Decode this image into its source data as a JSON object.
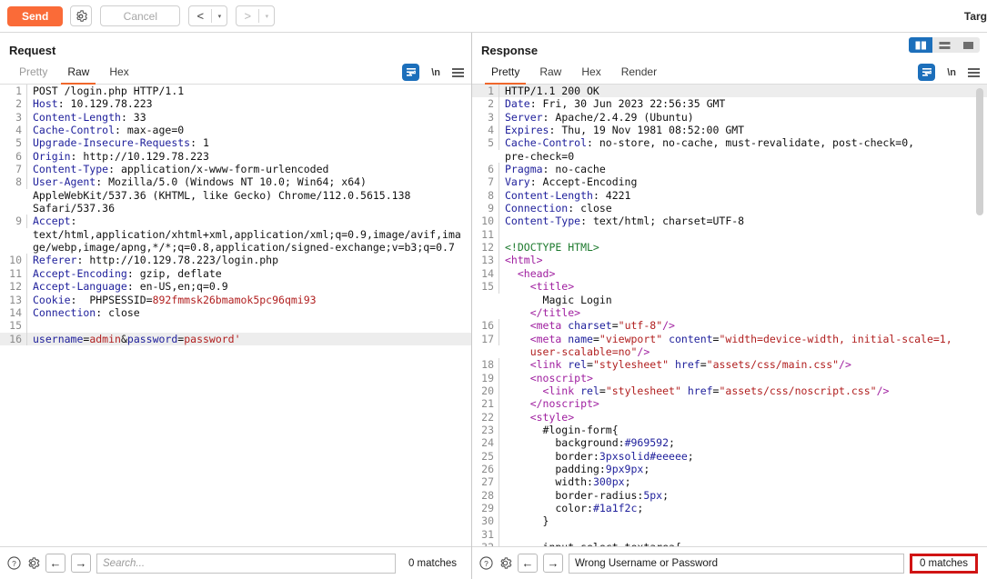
{
  "toolbar": {
    "send_label": "Send",
    "settings_icon": "gear-icon",
    "cancel_label": "Cancel",
    "prev_label": "<",
    "next_label": ">",
    "dropdown_caret": "▾",
    "target_label": "Targ"
  },
  "request": {
    "title": "Request",
    "tabs": [
      {
        "label": "Pretty",
        "active": false
      },
      {
        "label": "Raw",
        "active": true
      },
      {
        "label": "Hex",
        "active": false
      }
    ],
    "tools": {
      "wrap_icon": "word-wrap-icon",
      "newline_label": "\\n",
      "menu_icon": "hamburger-menu-icon"
    },
    "search": {
      "placeholder": "Search...",
      "value": "",
      "matches": "0 matches",
      "help_icon": "help-icon",
      "settings_icon": "gear-icon",
      "prev_icon": "arrow-left-icon",
      "next_icon": "arrow-right-icon"
    },
    "lines": [
      {
        "n": "1",
        "parts": [
          {
            "t": "POST /login.php HTTP/1.1",
            "c": "k-val"
          }
        ]
      },
      {
        "n": "2",
        "parts": [
          {
            "t": "Host",
            "c": "k-hdr"
          },
          {
            "t": ": 10.129.78.223",
            "c": "k-val"
          }
        ]
      },
      {
        "n": "3",
        "parts": [
          {
            "t": "Content-Length",
            "c": "k-hdr"
          },
          {
            "t": ": 33",
            "c": "k-val"
          }
        ]
      },
      {
        "n": "4",
        "parts": [
          {
            "t": "Cache-Control",
            "c": "k-hdr"
          },
          {
            "t": ": max-age=0",
            "c": "k-val"
          }
        ]
      },
      {
        "n": "5",
        "parts": [
          {
            "t": "Upgrade-Insecure-Requests",
            "c": "k-hdr"
          },
          {
            "t": ": 1",
            "c": "k-val"
          }
        ]
      },
      {
        "n": "6",
        "parts": [
          {
            "t": "Origin",
            "c": "k-hdr"
          },
          {
            "t": ": http://10.129.78.223",
            "c": "k-val"
          }
        ]
      },
      {
        "n": "7",
        "parts": [
          {
            "t": "Content-Type",
            "c": "k-hdr"
          },
          {
            "t": ": application/x-www-form-urlencoded",
            "c": "k-val"
          }
        ]
      },
      {
        "n": "8",
        "parts": [
          {
            "t": "User-Agent",
            "c": "k-hdr"
          },
          {
            "t": ": Mozilla/5.0 (Windows NT 10.0; Win64; x64)",
            "c": "k-val"
          }
        ]
      },
      {
        "n": "",
        "parts": [
          {
            "t": "AppleWebKit/537.36 (KHTML, like Gecko) Chrome/112.0.5615.138",
            "c": "k-val"
          }
        ]
      },
      {
        "n": "",
        "parts": [
          {
            "t": "Safari/537.36",
            "c": "k-val"
          }
        ]
      },
      {
        "n": "9",
        "parts": [
          {
            "t": "Accept",
            "c": "k-hdr"
          },
          {
            "t": ":",
            "c": "k-val"
          }
        ]
      },
      {
        "n": "",
        "parts": [
          {
            "t": "text/html,application/xhtml+xml,application/xml;q=0.9,image/avif,ima",
            "c": "k-val"
          }
        ]
      },
      {
        "n": "",
        "parts": [
          {
            "t": "ge/webp,image/apng,*/*;q=0.8,application/signed-exchange;v=b3;q=0.7",
            "c": "k-val"
          }
        ]
      },
      {
        "n": "10",
        "parts": [
          {
            "t": "Referer",
            "c": "k-hdr"
          },
          {
            "t": ": http://10.129.78.223/login.php",
            "c": "k-val"
          }
        ]
      },
      {
        "n": "11",
        "parts": [
          {
            "t": "Accept-Encoding",
            "c": "k-hdr"
          },
          {
            "t": ": gzip, deflate",
            "c": "k-val"
          }
        ]
      },
      {
        "n": "12",
        "parts": [
          {
            "t": "Accept-Language",
            "c": "k-hdr"
          },
          {
            "t": ": en-US,en;q=0.9",
            "c": "k-val"
          }
        ]
      },
      {
        "n": "13",
        "parts": [
          {
            "t": "Cookie",
            "c": "k-hdr"
          },
          {
            "t": ":  PHPSESSID=",
            "c": "k-val"
          },
          {
            "t": "892fmmsk26bmamok5pc96qmi93",
            "c": "k-red"
          }
        ]
      },
      {
        "n": "14",
        "parts": [
          {
            "t": "Connection",
            "c": "k-hdr"
          },
          {
            "t": ": close",
            "c": "k-val"
          }
        ]
      },
      {
        "n": "15",
        "parts": [
          {
            "t": "",
            "c": "k-val"
          }
        ]
      },
      {
        "n": "16",
        "hl": true,
        "parts": [
          {
            "t": "username",
            "c": "k-hdr"
          },
          {
            "t": "=",
            "c": "k-val"
          },
          {
            "t": "admin",
            "c": "k-red"
          },
          {
            "t": "&",
            "c": "k-val"
          },
          {
            "t": "password",
            "c": "k-hdr"
          },
          {
            "t": "=",
            "c": "k-val"
          },
          {
            "t": "password'",
            "c": "k-red"
          }
        ]
      }
    ]
  },
  "response": {
    "title": "Response",
    "tabs": [
      {
        "label": "Pretty",
        "active": true
      },
      {
        "label": "Raw",
        "active": false
      },
      {
        "label": "Hex",
        "active": false
      },
      {
        "label": "Render",
        "active": false
      }
    ],
    "tools": {
      "wrap_icon": "word-wrap-icon",
      "newline_label": "\\n",
      "menu_icon": "hamburger-menu-icon"
    },
    "layout_toggles": [
      {
        "name": "side-by-side-layout",
        "active": true
      },
      {
        "name": "stacked-layout",
        "active": false
      },
      {
        "name": "single-pane-layout",
        "active": false
      }
    ],
    "search": {
      "placeholder": "Search...",
      "value": "Wrong Username or Password",
      "matches": "0 matches",
      "help_icon": "help-icon",
      "settings_icon": "gear-icon",
      "prev_icon": "arrow-left-icon",
      "next_icon": "arrow-right-icon"
    },
    "lines": [
      {
        "n": "1",
        "hl": true,
        "parts": [
          {
            "t": "HTTP/1.1 200 OK",
            "c": "k-val"
          }
        ]
      },
      {
        "n": "2",
        "parts": [
          {
            "t": "Date",
            "c": "k-hdr"
          },
          {
            "t": ": Fri, 30 Jun 2023 22:56:35 GMT",
            "c": "k-val"
          }
        ]
      },
      {
        "n": "3",
        "parts": [
          {
            "t": "Server",
            "c": "k-hdr"
          },
          {
            "t": ": Apache/2.4.29 (Ubuntu)",
            "c": "k-val"
          }
        ]
      },
      {
        "n": "4",
        "parts": [
          {
            "t": "Expires",
            "c": "k-hdr"
          },
          {
            "t": ": Thu, 19 Nov 1981 08:52:00 GMT",
            "c": "k-val"
          }
        ]
      },
      {
        "n": "5",
        "parts": [
          {
            "t": "Cache-Control",
            "c": "k-hdr"
          },
          {
            "t": ": no-store, no-cache, must-revalidate, post-check=0,",
            "c": "k-val"
          }
        ]
      },
      {
        "n": "",
        "parts": [
          {
            "t": "pre-check=0",
            "c": "k-val"
          }
        ]
      },
      {
        "n": "6",
        "parts": [
          {
            "t": "Pragma",
            "c": "k-hdr"
          },
          {
            "t": ": no-cache",
            "c": "k-val"
          }
        ]
      },
      {
        "n": "7",
        "parts": [
          {
            "t": "Vary",
            "c": "k-hdr"
          },
          {
            "t": ": Accept-Encoding",
            "c": "k-val"
          }
        ]
      },
      {
        "n": "8",
        "parts": [
          {
            "t": "Content-Length",
            "c": "k-hdr"
          },
          {
            "t": ": 4221",
            "c": "k-val"
          }
        ]
      },
      {
        "n": "9",
        "parts": [
          {
            "t": "Connection",
            "c": "k-hdr"
          },
          {
            "t": ": close",
            "c": "k-val"
          }
        ]
      },
      {
        "n": "10",
        "parts": [
          {
            "t": "Content-Type",
            "c": "k-hdr"
          },
          {
            "t": ": text/html; charset=UTF-8",
            "c": "k-val"
          }
        ]
      },
      {
        "n": "11",
        "parts": [
          {
            "t": "",
            "c": "k-val"
          }
        ]
      },
      {
        "n": "12",
        "parts": [
          {
            "t": "<!DOCTYPE HTML>",
            "c": "k-green"
          }
        ]
      },
      {
        "n": "13",
        "parts": [
          {
            "t": "<html>",
            "c": "k-tag"
          }
        ]
      },
      {
        "n": "14",
        "parts": [
          {
            "t": "  <head>",
            "c": "k-tag"
          }
        ]
      },
      {
        "n": "15",
        "parts": [
          {
            "t": "    <title>",
            "c": "k-tag"
          }
        ]
      },
      {
        "n": "",
        "parts": [
          {
            "t": "      Magic Login",
            "c": "k-val"
          }
        ]
      },
      {
        "n": "",
        "parts": [
          {
            "t": "    </title>",
            "c": "k-tag"
          }
        ]
      },
      {
        "n": "16",
        "parts": [
          {
            "t": "    <meta ",
            "c": "k-tag"
          },
          {
            "t": "charset",
            "c": "k-attr"
          },
          {
            "t": "=",
            "c": "k-val"
          },
          {
            "t": "\"utf-8\"",
            "c": "k-str"
          },
          {
            "t": "/>",
            "c": "k-tag"
          }
        ]
      },
      {
        "n": "17",
        "parts": [
          {
            "t": "    <meta ",
            "c": "k-tag"
          },
          {
            "t": "name",
            "c": "k-attr"
          },
          {
            "t": "=",
            "c": "k-val"
          },
          {
            "t": "\"viewport\"",
            "c": "k-str"
          },
          {
            "t": " ",
            "c": "k-val"
          },
          {
            "t": "content",
            "c": "k-attr"
          },
          {
            "t": "=",
            "c": "k-val"
          },
          {
            "t": "\"width=device-width, initial-scale=1,",
            "c": "k-str"
          }
        ]
      },
      {
        "n": "",
        "parts": [
          {
            "t": "    ",
            "c": "k-val"
          },
          {
            "t": "user-scalable=no\"",
            "c": "k-str"
          },
          {
            "t": "/>",
            "c": "k-tag"
          }
        ]
      },
      {
        "n": "18",
        "parts": [
          {
            "t": "    <link ",
            "c": "k-tag"
          },
          {
            "t": "rel",
            "c": "k-attr"
          },
          {
            "t": "=",
            "c": "k-val"
          },
          {
            "t": "\"stylesheet\"",
            "c": "k-str"
          },
          {
            "t": " ",
            "c": "k-val"
          },
          {
            "t": "href",
            "c": "k-attr"
          },
          {
            "t": "=",
            "c": "k-val"
          },
          {
            "t": "\"assets/css/main.css\"",
            "c": "k-str"
          },
          {
            "t": "/>",
            "c": "k-tag"
          }
        ]
      },
      {
        "n": "19",
        "parts": [
          {
            "t": "    <noscript>",
            "c": "k-tag"
          }
        ]
      },
      {
        "n": "20",
        "parts": [
          {
            "t": "      <link ",
            "c": "k-tag"
          },
          {
            "t": "rel",
            "c": "k-attr"
          },
          {
            "t": "=",
            "c": "k-val"
          },
          {
            "t": "\"stylesheet\"",
            "c": "k-str"
          },
          {
            "t": " ",
            "c": "k-val"
          },
          {
            "t": "href",
            "c": "k-attr"
          },
          {
            "t": "=",
            "c": "k-val"
          },
          {
            "t": "\"assets/css/noscript.css\"",
            "c": "k-str"
          },
          {
            "t": "/>",
            "c": "k-tag"
          }
        ]
      },
      {
        "n": "21",
        "parts": [
          {
            "t": "    </noscript>",
            "c": "k-tag"
          }
        ]
      },
      {
        "n": "22",
        "parts": [
          {
            "t": "    <style>",
            "c": "k-tag"
          }
        ]
      },
      {
        "n": "23",
        "parts": [
          {
            "t": "      #login-form{",
            "c": "k-css-prop"
          }
        ]
      },
      {
        "n": "24",
        "parts": [
          {
            "t": "        background:",
            "c": "k-css-prop"
          },
          {
            "t": "#969592",
            "c": "k-css-val"
          },
          {
            "t": ";",
            "c": "k-css-prop"
          }
        ]
      },
      {
        "n": "25",
        "parts": [
          {
            "t": "        border:",
            "c": "k-css-prop"
          },
          {
            "t": "3pxsolid#eeeee",
            "c": "k-css-val"
          },
          {
            "t": ";",
            "c": "k-css-prop"
          }
        ]
      },
      {
        "n": "26",
        "parts": [
          {
            "t": "        padding:",
            "c": "k-css-prop"
          },
          {
            "t": "9px9px",
            "c": "k-css-val"
          },
          {
            "t": ";",
            "c": "k-css-prop"
          }
        ]
      },
      {
        "n": "27",
        "parts": [
          {
            "t": "        width:",
            "c": "k-css-prop"
          },
          {
            "t": "300px",
            "c": "k-css-val"
          },
          {
            "t": ";",
            "c": "k-css-prop"
          }
        ]
      },
      {
        "n": "28",
        "parts": [
          {
            "t": "        border-radius:",
            "c": "k-css-prop"
          },
          {
            "t": "5px",
            "c": "k-css-val"
          },
          {
            "t": ";",
            "c": "k-css-prop"
          }
        ]
      },
      {
        "n": "29",
        "parts": [
          {
            "t": "        color:",
            "c": "k-css-prop"
          },
          {
            "t": "#1a1f2c",
            "c": "k-css-val"
          },
          {
            "t": ";",
            "c": "k-css-prop"
          }
        ]
      },
      {
        "n": "30",
        "parts": [
          {
            "t": "      }",
            "c": "k-css-prop"
          }
        ]
      },
      {
        "n": "31",
        "parts": [
          {
            "t": "",
            "c": "k-val"
          }
        ]
      },
      {
        "n": "32",
        "parts": [
          {
            "t": "      input,select,textarea{",
            "c": "k-css-prop"
          }
        ]
      }
    ]
  }
}
